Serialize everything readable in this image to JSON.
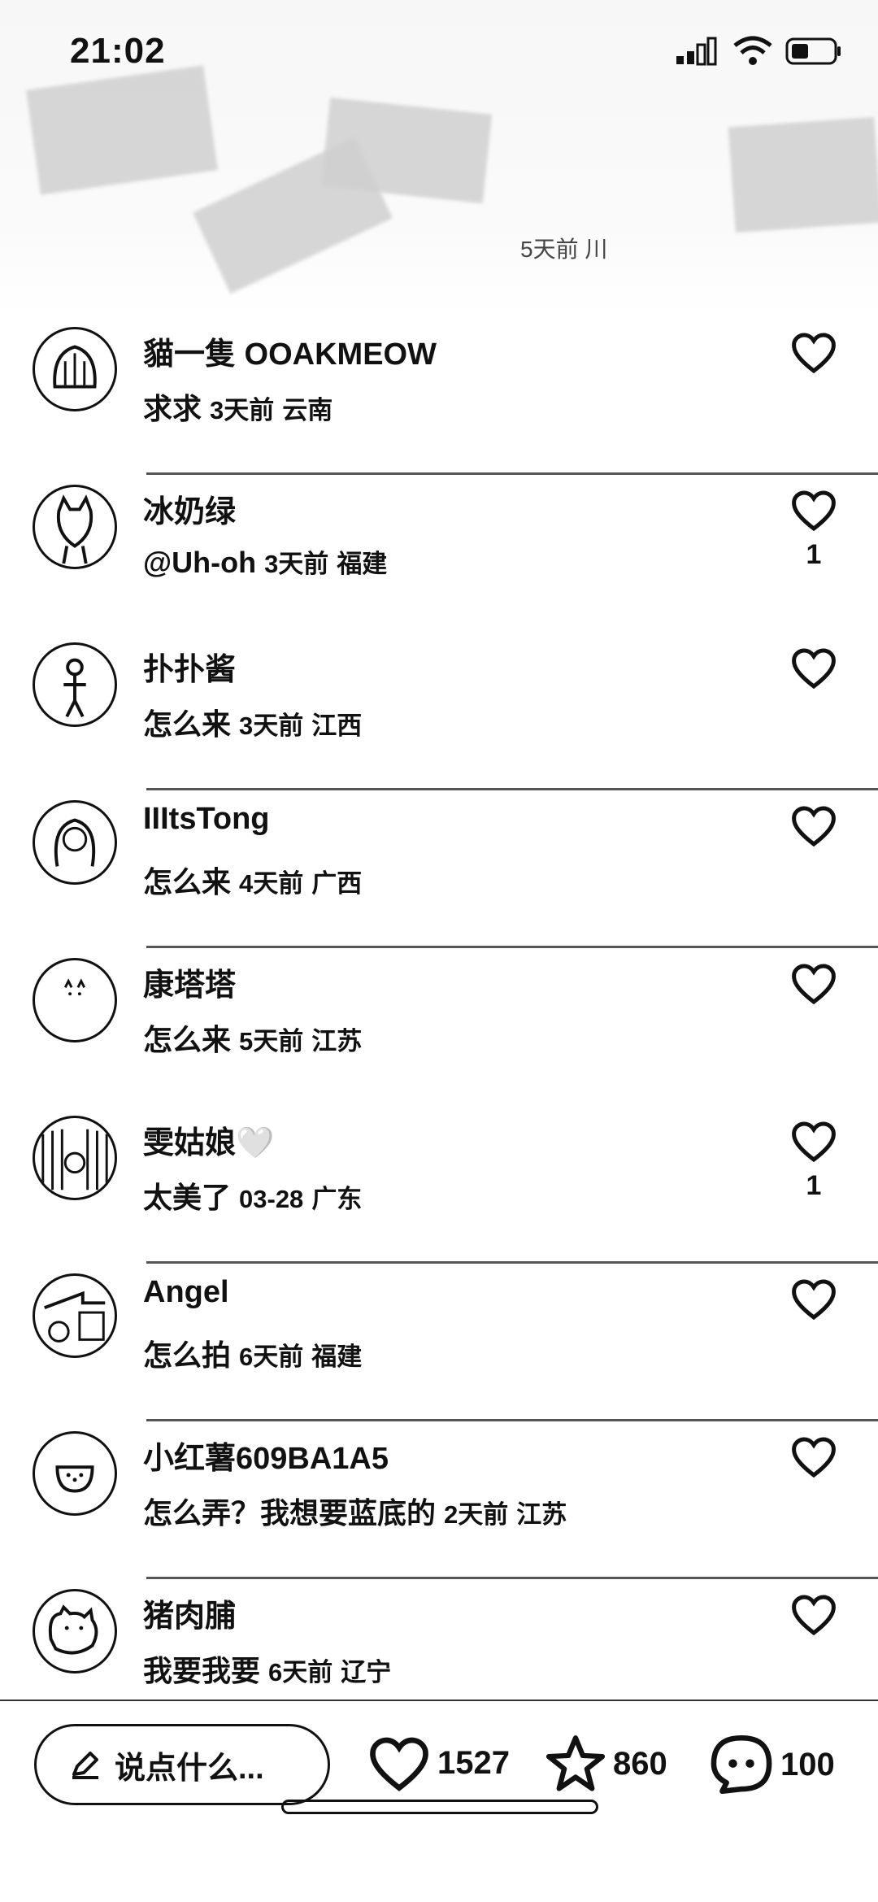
{
  "status_bar": {
    "time": "21:02"
  },
  "hero": {
    "caption": "5天前 川"
  },
  "comments": [
    {
      "name": "貓一隻 OOAKMEOW",
      "text": "求求",
      "time": "3天前",
      "location": "云南",
      "likes": ""
    },
    {
      "name": "冰奶绿",
      "text": "@Uh-oh",
      "time": "3天前",
      "location": "福建",
      "likes": "1"
    },
    {
      "name": "扑扑酱",
      "text": "怎么来",
      "time": "3天前",
      "location": "江西",
      "likes": ""
    },
    {
      "name": "IIItsTong",
      "text": "怎么来",
      "time": "4天前",
      "location": "广西",
      "likes": ""
    },
    {
      "name": "康塔塔",
      "text": "怎么来",
      "time": "5天前",
      "location": "江苏",
      "likes": ""
    },
    {
      "name": "雯姑娘🤍",
      "text": "太美了",
      "time": "03-28",
      "location": "广东",
      "likes": "1"
    },
    {
      "name": "Angel",
      "text": "怎么拍",
      "time": "6天前",
      "location": "福建",
      "likes": ""
    },
    {
      "name": "小红薯609BA1A5",
      "text": "怎么弄？我想要蓝底的",
      "time": "2天前",
      "location": "江苏",
      "likes": ""
    },
    {
      "name": "猪肉脯",
      "text": "我要我要",
      "time": "6天前",
      "location": "辽宁",
      "likes": ""
    }
  ],
  "bottom_bar": {
    "input_placeholder": "说点什么...",
    "likes": "1527",
    "collects": "860",
    "comments": "100"
  }
}
